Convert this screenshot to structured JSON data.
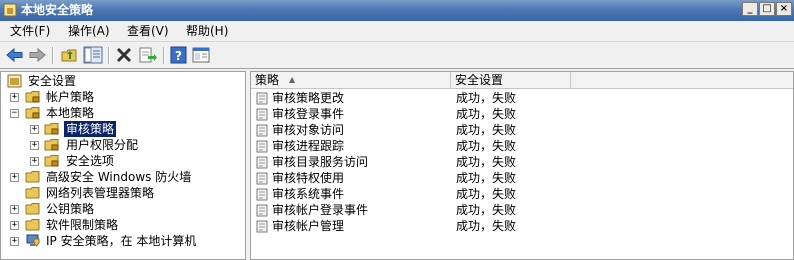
{
  "window": {
    "title": "本地安全策略",
    "btn_min": "_",
    "btn_max": "□",
    "btn_close": "×"
  },
  "menu": [
    {
      "label": "文件(F)"
    },
    {
      "label": "操作(A)"
    },
    {
      "label": "查看(V)"
    },
    {
      "label": "帮助(H)"
    }
  ],
  "toolbar": {
    "buttons": [
      "back-arrow-icon",
      "forward-arrow-icon",
      "up-folder-icon",
      "show-tree-icon",
      "delete-icon",
      "export-icon",
      "help-icon",
      "properties-icon"
    ]
  },
  "tree": {
    "root": "安全设置",
    "items": [
      {
        "label": "帐户策略"
      },
      {
        "label": "本地策略"
      },
      {
        "label": "审核策略"
      },
      {
        "label": "用户权限分配"
      },
      {
        "label": "安全选项"
      },
      {
        "label": "高级安全 Windows 防火墙"
      },
      {
        "label": "网络列表管理器策略"
      },
      {
        "label": "公钥策略"
      },
      {
        "label": "软件限制策略"
      },
      {
        "label": "IP 安全策略，在 本地计算机"
      }
    ]
  },
  "list": {
    "columns": {
      "policy": "策略",
      "setting": "安全设置"
    },
    "sort_indicator": "▲",
    "rows": [
      {
        "name": "审核策略更改",
        "setting": "成功，失败"
      },
      {
        "name": "审核登录事件",
        "setting": "成功，失败"
      },
      {
        "name": "审核对象访问",
        "setting": "成功，失败"
      },
      {
        "name": "审核进程跟踪",
        "setting": "成功，失败"
      },
      {
        "name": "审核目录服务访问",
        "setting": "成功，失败"
      },
      {
        "name": "审核特权使用",
        "setting": "成功，失败"
      },
      {
        "name": "审核系统事件",
        "setting": "成功，失败"
      },
      {
        "name": "审核帐户登录事件",
        "setting": "成功，失败"
      },
      {
        "name": "审核帐户管理",
        "setting": "成功，失败"
      }
    ]
  },
  "colors": {
    "title_bar": "#4e78b5",
    "selection": "#0a246a",
    "folder": "#e8c65a"
  }
}
